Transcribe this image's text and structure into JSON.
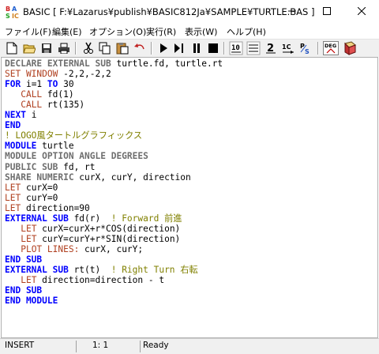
{
  "window": {
    "title": "BASIC [ F:¥Lazarus¥publish¥BASIC812Ja¥SAMPLE¥TURTLE.BAS ]"
  },
  "window_controls": {
    "minimize": "—",
    "maximize": "☐",
    "close": "✕"
  },
  "menu": [
    {
      "label": "ファイル(F)"
    },
    {
      "label": "編集(E)"
    },
    {
      "label": "オプション(O)"
    },
    {
      "label": "実行(R)"
    },
    {
      "label": "表示(W)"
    },
    {
      "label": "ヘルプ(H)"
    }
  ],
  "toolbar": {
    "icons": [
      "new-file-icon",
      "open-folder-icon",
      "save-icon",
      "print-icon",
      "cut-icon",
      "copy-icon",
      "paste-icon",
      "undo-icon",
      "run-icon",
      "step-icon",
      "pause-icon",
      "break-icon",
      "number-icon",
      "output-icon",
      "unnumber-icon",
      "char-icon",
      "help-icon",
      "deg-icon",
      "book-icon"
    ],
    "deg_label": "DEG",
    "num_label": "10",
    "c_label": "1C",
    "p_label": "P"
  },
  "code": [
    {
      "segments": [
        {
          "t": "DECLARE EXTERNAL SUB",
          "c": "kw-gray"
        },
        {
          "t": " turtle.fd, turtle.rt",
          "c": "plain"
        }
      ]
    },
    {
      "segments": [
        {
          "t": "SET WINDOW",
          "c": "kw-red"
        },
        {
          "t": " -2,2,-2,2",
          "c": "plain"
        }
      ]
    },
    {
      "segments": [
        {
          "t": "FOR",
          "c": "kw-blue"
        },
        {
          "t": " i=1 ",
          "c": "plain"
        },
        {
          "t": "TO",
          "c": "kw-blue"
        },
        {
          "t": " 30",
          "c": "plain"
        }
      ]
    },
    {
      "segments": [
        {
          "t": "   ",
          "c": "plain"
        },
        {
          "t": "CALL",
          "c": "kw-red"
        },
        {
          "t": " fd(1)",
          "c": "plain"
        }
      ]
    },
    {
      "segments": [
        {
          "t": "   ",
          "c": "plain"
        },
        {
          "t": "CALL",
          "c": "kw-red"
        },
        {
          "t": " rt(135)",
          "c": "plain"
        }
      ]
    },
    {
      "segments": [
        {
          "t": "NEXT",
          "c": "kw-blue"
        },
        {
          "t": " i",
          "c": "plain"
        }
      ]
    },
    {
      "segments": [
        {
          "t": "END",
          "c": "kw-blue"
        }
      ]
    },
    {
      "segments": [
        {
          "t": "! LOGO風タートルグラフィックス",
          "c": "comment"
        }
      ]
    },
    {
      "segments": [
        {
          "t": "MODULE",
          "c": "kw-blue"
        },
        {
          "t": " turtle",
          "c": "plain"
        }
      ]
    },
    {
      "segments": [
        {
          "t": "MODULE OPTION ANGLE DEGREES",
          "c": "kw-gray"
        }
      ]
    },
    {
      "segments": [
        {
          "t": "PUBLIC SUB",
          "c": "kw-gray"
        },
        {
          "t": " fd, rt",
          "c": "plain"
        }
      ]
    },
    {
      "segments": [
        {
          "t": "SHARE NUMERIC",
          "c": "kw-gray"
        },
        {
          "t": " curX, curY, direction",
          "c": "plain"
        }
      ]
    },
    {
      "segments": [
        {
          "t": "LET",
          "c": "kw-red"
        },
        {
          "t": " curX=0",
          "c": "plain"
        }
      ]
    },
    {
      "segments": [
        {
          "t": "LET",
          "c": "kw-red"
        },
        {
          "t": " curY=0",
          "c": "plain"
        }
      ]
    },
    {
      "segments": [
        {
          "t": "LET",
          "c": "kw-red"
        },
        {
          "t": " direction=90",
          "c": "plain"
        }
      ]
    },
    {
      "segments": [
        {
          "t": "EXTERNAL SUB",
          "c": "kw-blue"
        },
        {
          "t": " fd(r)  ",
          "c": "plain"
        },
        {
          "t": "! Forward 前進",
          "c": "comment"
        }
      ]
    },
    {
      "segments": [
        {
          "t": "   ",
          "c": "plain"
        },
        {
          "t": "LET",
          "c": "kw-red"
        },
        {
          "t": " curX=curX+r*COS(direction)",
          "c": "plain"
        }
      ]
    },
    {
      "segments": [
        {
          "t": "   ",
          "c": "plain"
        },
        {
          "t": "LET",
          "c": "kw-red"
        },
        {
          "t": " curY=curY+r*SIN(direction)",
          "c": "plain"
        }
      ]
    },
    {
      "segments": [
        {
          "t": "   ",
          "c": "plain"
        },
        {
          "t": "PLOT LINES:",
          "c": "kw-red"
        },
        {
          "t": " curX, curY;",
          "c": "plain"
        }
      ]
    },
    {
      "segments": [
        {
          "t": "END SUB",
          "c": "kw-blue"
        }
      ]
    },
    {
      "segments": [
        {
          "t": "EXTERNAL SUB",
          "c": "kw-blue"
        },
        {
          "t": " rt(t)  ",
          "c": "plain"
        },
        {
          "t": "! Right Turn 右転",
          "c": "comment"
        }
      ]
    },
    {
      "segments": [
        {
          "t": "   ",
          "c": "plain"
        },
        {
          "t": "LET",
          "c": "kw-red"
        },
        {
          "t": " direction=direction - t",
          "c": "plain"
        }
      ]
    },
    {
      "segments": [
        {
          "t": "END SUB",
          "c": "kw-blue"
        }
      ]
    },
    {
      "segments": [
        {
          "t": "END MODULE",
          "c": "kw-blue"
        }
      ]
    }
  ],
  "status": {
    "mode": "INSERT",
    "position": "1:  1",
    "message": "Ready"
  }
}
